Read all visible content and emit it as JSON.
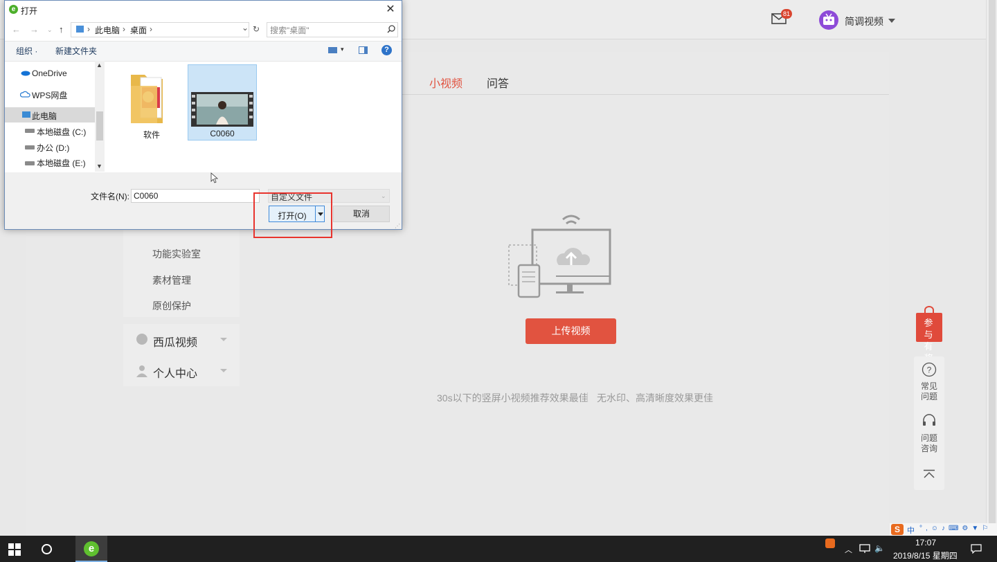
{
  "header": {
    "mail_badge": "81",
    "username": "简调视频"
  },
  "tabs": {
    "active": "小视频",
    "other": "问答"
  },
  "sidebar": {
    "items": [
      "功能实验室",
      "素材管理",
      "原创保护"
    ],
    "groups": [
      "西瓜视频",
      "个人中心"
    ]
  },
  "upload": {
    "button_label": "上传视频",
    "hint_left": "30s以下的竖屏小视频推荐效果最佳",
    "hint_right": "无水印、高清晰度效果更佳"
  },
  "float": {
    "gift_line1": "参 与",
    "gift_line2": "有 奖",
    "faq_line1": "常见",
    "faq_line2": "问题",
    "consult_line1": "问题",
    "consult_line2": "咨询"
  },
  "dialog": {
    "title": "打开",
    "breadcrumb": [
      "此电脑",
      "桌面"
    ],
    "search_placeholder": "搜索\"桌面\"",
    "toolbar": {
      "organize": "组织 ·",
      "new_folder": "新建文件夹"
    },
    "tree": [
      "OneDrive",
      "WPS网盘",
      "此电脑",
      "本地磁盘 (C:)",
      "办公 (D:)",
      "本地磁盘 (E:)"
    ],
    "files": [
      "软件",
      "C0060"
    ],
    "filename_label": "文件名(N):",
    "filename_value": "C0060",
    "filetype": "自定义文件",
    "open_label": "打开(O)",
    "cancel_label": "取消"
  },
  "taskbar": {
    "time": "17:07",
    "date": "2019/8/15 星期四",
    "ime_mode": "中"
  },
  "colors": {
    "accent": "#e15340",
    "highlight_box": "#e8332d",
    "dialog_border": "#6a8bb7"
  }
}
